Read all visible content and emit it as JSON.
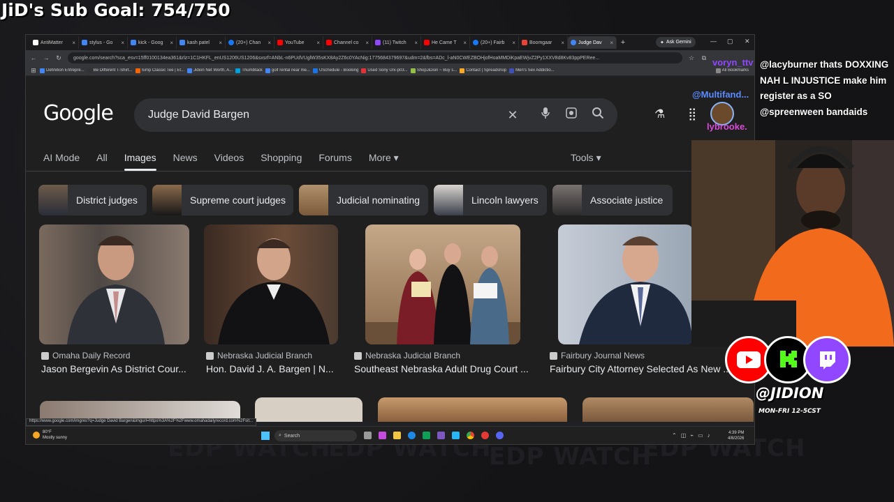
{
  "stream": {
    "sub_goal": "JiD's Sub Goal: 754/750",
    "watermark": "EDP WATCH",
    "social_handle": "@JIDION",
    "schedule": "MON-FRI 12-5CST"
  },
  "chat": {
    "messages": [
      {
        "user": "@lacyburner",
        "text": "thats DOXXING"
      },
      {
        "user": "",
        "text": "NAH L INJUSTICE make him register as a SO"
      },
      {
        "user": "@spreenween",
        "text": "bandaids"
      }
    ],
    "names": [
      "voryn_ttv",
      "@Multifand...",
      "lybrooke."
    ]
  },
  "browser": {
    "tabs": [
      {
        "label": "AntiMatter",
        "color": "#ffffff"
      },
      {
        "label": "stylus - Go",
        "color": "#4285f4"
      },
      {
        "label": "kick - Goog",
        "color": "#4285f4"
      },
      {
        "label": "kash patel",
        "color": "#4285f4"
      },
      {
        "label": "(20+) Chan",
        "color": "#1877f2"
      },
      {
        "label": "YouTube",
        "color": "#ff0000"
      },
      {
        "label": "Channel co",
        "color": "#ff0000"
      },
      {
        "label": "(11) Twitch",
        "color": "#9146ff"
      },
      {
        "label": "He Came T",
        "color": "#ff0000"
      },
      {
        "label": "(20+) Fairb",
        "color": "#1877f2"
      },
      {
        "label": "Boomgaar",
        "color": "#ea4335"
      },
      {
        "label": "Judge Dav",
        "color": "#4285f4",
        "active": true
      }
    ],
    "ask_gemini": "Ask Gemini",
    "url": "google.com/search?sca_esv=15ff0100134ea361&rlz=1C1HKFL_enUS1206US1206&sxsrf=ANbL-n6PUdVUglW35sKX8Ay2Z6c0YAcNig:1775684379697&udm=2&fbs=ADc_l-aN0CWEZBOHjofHoaMMDiKpaEWjvZ2Py1XXV8d8Kv83ppPERee...",
    "bookmarks": [
      "Definition Entrepre...",
      "Be Different T-Shirt...",
      "Simp Classic Tee | Et...",
      "Jidion Net Worth, A...",
      "Thumbtack",
      "golf rental near me...",
      "USchedule - Booking",
      "Used Sony Urx-p03...",
      "ShopJiDion ~ Buy s...",
      "Contact | Spreadshop",
      "Men's Sex Addictio...",
      "All Bookmarks"
    ],
    "status_url": "https://www.google.com/imgres?q=Judge David Bargen&imgurl=https%3A%2F%2Fwww.omahadailyrecord.com%2Fsit..."
  },
  "google": {
    "logo": "Google",
    "query": "Judge David Bargen",
    "tabs": [
      "AI Mode",
      "All",
      "Images",
      "News",
      "Videos",
      "Shopping",
      "Forums",
      "More"
    ],
    "active_tab": "Images",
    "tools": "Tools",
    "chips": [
      "District judges",
      "Supreme court judges",
      "Judicial nominating",
      "Lincoln lawyers",
      "Associate justice"
    ],
    "results": [
      {
        "source": "Omaha Daily Record",
        "title": "Jason Bergevin As District Cour..."
      },
      {
        "source": "Nebraska Judicial Branch",
        "title": "Hon. David J. A. Bargen | N..."
      },
      {
        "source": "Nebraska Judicial Branch",
        "title": "Southeast Nebraska Adult Drug Court ..."
      },
      {
        "source": "Fairbury Journal News",
        "title": "Fairbury City Attorney Selected As New ..."
      }
    ]
  },
  "taskbar": {
    "weather_temp": "80°F",
    "weather_desc": "Mostly sunny",
    "search": "Search",
    "time": "4:39 PM",
    "date": "4/8/2026"
  }
}
